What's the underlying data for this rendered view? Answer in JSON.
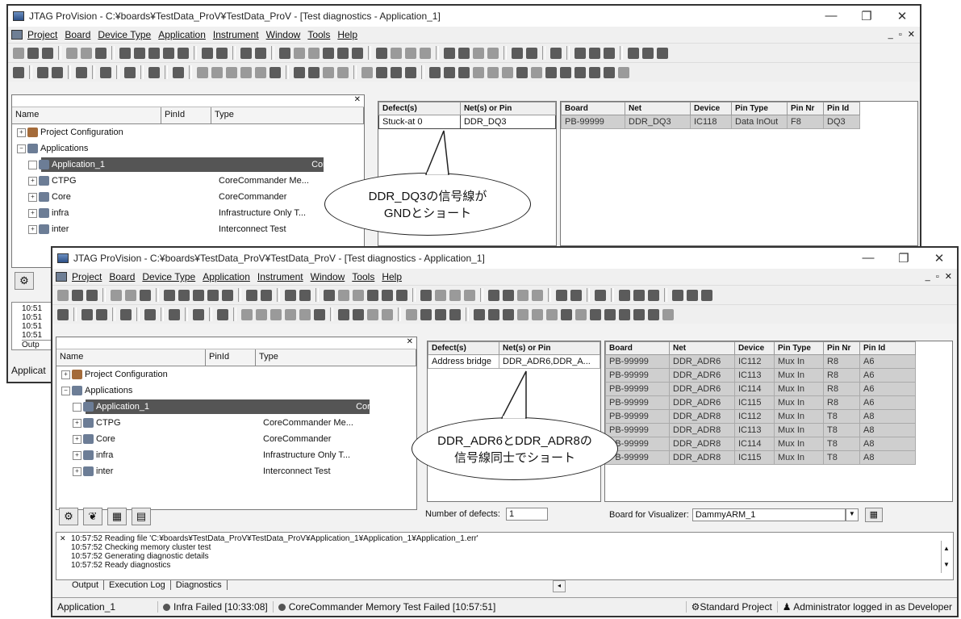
{
  "window_back": {
    "title": "JTAG ProVision - C:¥boards¥TestData_ProV¥TestData_ProV - [Test diagnostics - Application_1]",
    "menu": [
      "Project",
      "Board",
      "Device Type",
      "Application",
      "Instrument",
      "Window",
      "Tools",
      "Help"
    ],
    "tree_headers": {
      "name": "Name",
      "pinid": "PinId",
      "type": "Type"
    },
    "tree_items": [
      {
        "name": "Project Configuration",
        "type": ""
      },
      {
        "name": "Applications",
        "type": ""
      },
      {
        "name": "Application_1",
        "type": "CoreCommander Me..."
      },
      {
        "name": "CTPG",
        "type": "CoreCommander Me..."
      },
      {
        "name": "Core",
        "type": "CoreCommander"
      },
      {
        "name": "infra",
        "type": "Infrastructure Only T..."
      },
      {
        "name": "inter",
        "type": "Interconnect Test"
      }
    ],
    "defects": {
      "headers": [
        "Defect(s)",
        "Net(s) or Pin"
      ],
      "rows": [
        [
          "Stuck-at 0",
          "DDR_DQ3"
        ]
      ]
    },
    "detail": {
      "headers": [
        "Board",
        "Net",
        "Device",
        "Pin Type",
        "Pin Nr",
        "Pin Id"
      ],
      "rows": [
        [
          "PB-99999",
          "DDR_DQ3",
          "IC118",
          "Data InOut",
          "F8",
          "DQ3"
        ]
      ]
    },
    "callout": {
      "line1": "DDR_DQ3の信号線が",
      "line2": "GNDとショート"
    },
    "log_times": [
      "10:51",
      "10:51",
      "10:51",
      "10:51"
    ],
    "tab_partial": "Outp",
    "status_partial": "Applicat"
  },
  "window_front": {
    "title": "JTAG ProVision - C:¥boards¥TestData_ProV¥TestData_ProV - [Test diagnostics - Application_1]",
    "menu": [
      "Project",
      "Board",
      "Device Type",
      "Application",
      "Instrument",
      "Window",
      "Tools",
      "Help"
    ],
    "tree_headers": {
      "name": "Name",
      "pinid": "PinId",
      "type": "Type"
    },
    "tree_items": [
      {
        "name": "Project Configuration",
        "type": ""
      },
      {
        "name": "Applications",
        "type": ""
      },
      {
        "name": "Application_1",
        "type": "CoreCommander Me..."
      },
      {
        "name": "CTPG",
        "type": "CoreCommander Me..."
      },
      {
        "name": "Core",
        "type": "CoreCommander"
      },
      {
        "name": "infra",
        "type": "Infrastructure Only T..."
      },
      {
        "name": "inter",
        "type": "Interconnect Test"
      }
    ],
    "defects": {
      "headers": [
        "Defect(s)",
        "Net(s) or Pin"
      ],
      "rows": [
        [
          "Address bridge",
          "DDR_ADR6,DDR_A..."
        ]
      ]
    },
    "detail": {
      "headers": [
        "Board",
        "Net",
        "Device",
        "Pin Type",
        "Pin Nr",
        "Pin Id"
      ],
      "rows": [
        [
          "PB-99999",
          "DDR_ADR6",
          "IC112",
          "Mux In",
          "R8",
          "A6"
        ],
        [
          "PB-99999",
          "DDR_ADR6",
          "IC113",
          "Mux In",
          "R8",
          "A6"
        ],
        [
          "PB-99999",
          "DDR_ADR6",
          "IC114",
          "Mux In",
          "R8",
          "A6"
        ],
        [
          "PB-99999",
          "DDR_ADR6",
          "IC115",
          "Mux In",
          "R8",
          "A6"
        ],
        [
          "PB-99999",
          "DDR_ADR8",
          "IC112",
          "Mux In",
          "T8",
          "A8"
        ],
        [
          "PB-99999",
          "DDR_ADR8",
          "IC113",
          "Mux In",
          "T8",
          "A8"
        ],
        [
          "PB-99999",
          "DDR_ADR8",
          "IC114",
          "Mux In",
          "T8",
          "A8"
        ],
        [
          "PB-99999",
          "DDR_ADR8",
          "IC115",
          "Mux In",
          "T8",
          "A8"
        ]
      ]
    },
    "callout": {
      "line1": "DDR_ADR6とDDR_ADR8の",
      "line2": "信号線同士でショート"
    },
    "number_of_defects_label": "Number of defects:",
    "number_of_defects_value": "1",
    "board_label": "Board for Visualizer:",
    "board_value": "DammyARM_1",
    "log_lines": [
      "10:57:52  Reading file 'C:¥boards¥TestData_ProV¥TestData_ProV¥Application_1¥Application_1¥Application_1.err'",
      "10:57:52  Checking memory cluster test",
      "10:57:52  Generating diagnostic details",
      "10:57:52  Ready diagnostics"
    ],
    "log_tabs": [
      "Output",
      "Execution Log",
      "Diagnostics"
    ],
    "status": {
      "app": "Application_1",
      "infra": "Infra  Failed  [10:33:08]",
      "memtest": "CoreCommander Memory Test  Failed  [10:57:51]",
      "project": "Standard Project",
      "user": "Administrator logged in as Developer"
    }
  },
  "colors": {
    "selection": "#555555",
    "grid_grey": "#cfcfcf",
    "window_bg": "#f2f2f2"
  }
}
